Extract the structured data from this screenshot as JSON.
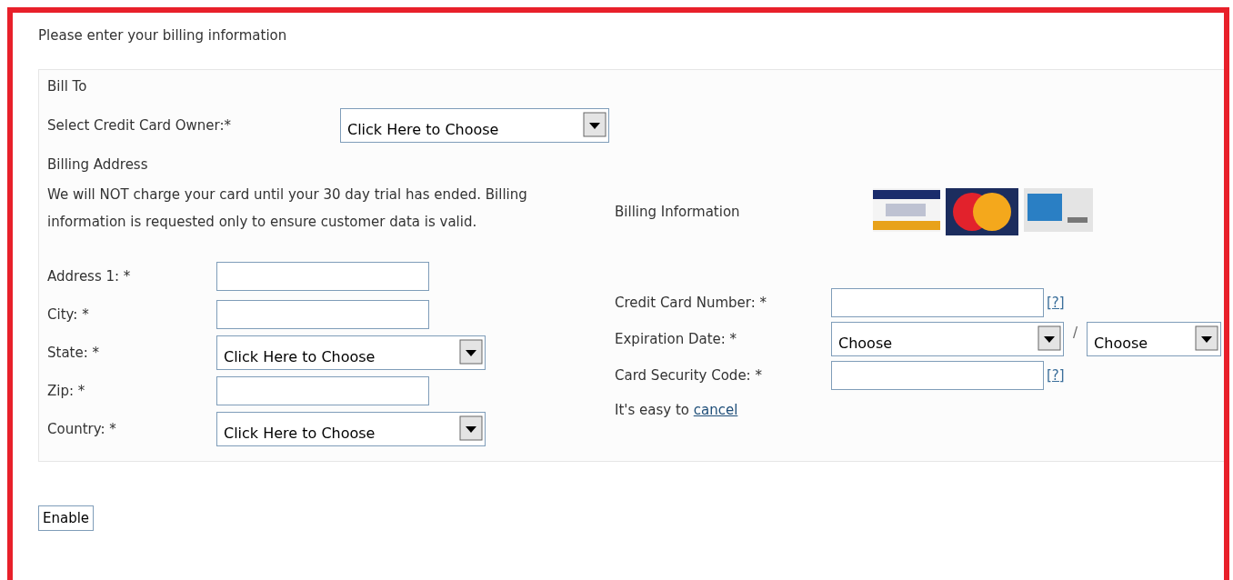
{
  "header": {
    "title": "Please enter your billing information"
  },
  "bill_to": {
    "heading": "Bill To",
    "owner": {
      "label": "Select Credit Card Owner:*",
      "value": "Click Here to Choose"
    }
  },
  "billing_address": {
    "heading": "Billing Address",
    "notice": "We will NOT charge your card until your 30 day trial has ended. Billing information is requested only to ensure customer data is valid.",
    "fields": [
      {
        "kind": "text",
        "label": "Address 1: *"
      },
      {
        "kind": "text",
        "label": "City: *"
      },
      {
        "kind": "select",
        "label": "State: *",
        "value": "Click Here to Choose"
      },
      {
        "kind": "text",
        "label": "Zip: *"
      },
      {
        "kind": "select",
        "label": "Country: *",
        "value": "Click Here to Choose"
      }
    ]
  },
  "billing_information": {
    "heading": "Billing Information",
    "cards": [
      {
        "kind": "visa"
      },
      {
        "kind": "mastercard"
      },
      {
        "kind": "amex"
      }
    ],
    "fields": [
      {
        "kind": "text",
        "label": "Credit Card Number: *",
        "help": "[?]"
      },
      {
        "kind": "date",
        "label": "Expiration Date: *",
        "month": "Choose",
        "separator": "/",
        "year": "Choose"
      },
      {
        "kind": "text",
        "label": "Card Security Code: *",
        "help": "[?]"
      }
    ],
    "cancel_note": {
      "text": "It's easy to",
      "link": "cancel"
    }
  },
  "button": "Enable"
}
